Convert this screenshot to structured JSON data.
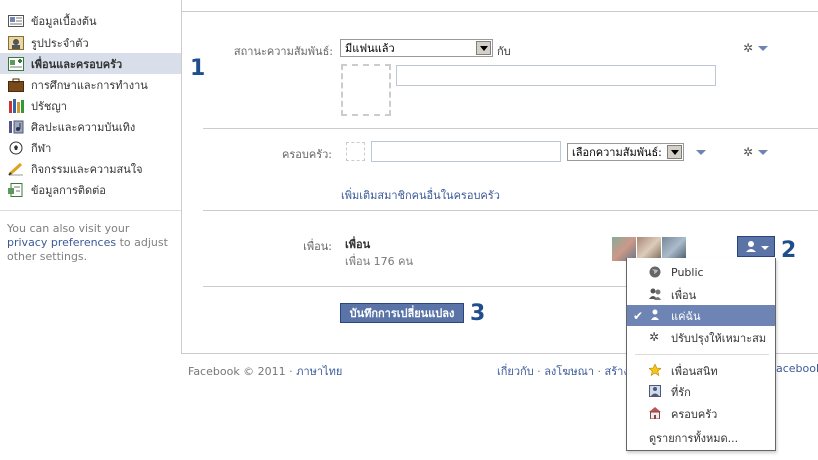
{
  "sidebar": {
    "items": [
      {
        "label": "ข้อมูลเบื้องต้น",
        "icon": "info-card-icon",
        "active": false
      },
      {
        "label": "รูปประจำตัว",
        "icon": "profile-picture-icon",
        "active": false
      },
      {
        "label": "เพื่อนและครอบครัว",
        "icon": "friends-family-icon",
        "active": true
      },
      {
        "label": "การศึกษาและการทำงาน",
        "icon": "briefcase-icon",
        "active": false
      },
      {
        "label": "ปรัชญา",
        "icon": "books-icon",
        "active": false
      },
      {
        "label": "ศิลปะและความบันเทิง",
        "icon": "music-icon",
        "active": false
      },
      {
        "label": "กีฬา",
        "icon": "soccer-ball-icon",
        "active": false
      },
      {
        "label": "กิจกรรมและความสนใจ",
        "icon": "pencil-icon",
        "active": false
      },
      {
        "label": "ข้อมูลการติดต่อ",
        "icon": "contact-icon",
        "active": false
      }
    ],
    "note_prefix": "You can also visit your ",
    "note_link": "privacy preferences",
    "note_suffix": " to adjust other settings."
  },
  "relationship": {
    "label": "สถานะความสัมพันธ์:",
    "select_value": "มีแฟนแล้ว",
    "with_label": "กับ",
    "number_marker": "1"
  },
  "family": {
    "label": "ครอบครัว:",
    "select_value": "เลือกความสัมพันธ์:",
    "add_link": "เพิ่มเติมสมาชิกคนอื่นในครอบครัว"
  },
  "friends": {
    "label": "เพื่อน:",
    "title": "เพื่อน",
    "count_text": "เพื่อน 176 คน",
    "number_marker": "2"
  },
  "save": {
    "label": "บันทึกการเปลี่ยนแปลง",
    "number_marker": "3"
  },
  "privacy_menu": {
    "items": [
      {
        "label": "Public",
        "icon": "globe-icon",
        "selected": false
      },
      {
        "label": "เพื่อน",
        "icon": "friends-icon",
        "selected": false
      },
      {
        "label": "แค่ฉัน",
        "icon": "person-icon",
        "selected": true
      },
      {
        "label": "ปรับปรุงให้เหมาะสม",
        "icon": "gear-icon",
        "selected": false
      },
      {
        "label": "เพื่อนสนิท",
        "icon": "star-icon",
        "selected": false
      },
      {
        "label": "ที่รัก",
        "icon": "partner-icon",
        "selected": false
      },
      {
        "label": "ครอบครัว",
        "icon": "house-icon",
        "selected": false
      }
    ],
    "see_all": "ดูรายการทั้งหมด...",
    "check_mark": "✔"
  },
  "footer": {
    "copyright": "Facebook © 2011",
    "dot": " · ",
    "language": "ภาษาไทย",
    "about": "เกี่ยวกับ",
    "ads": "ลงโฆษณา",
    "create": "สร้างเ",
    "facebook_tail": "acebook"
  },
  "colors": {
    "accent": "#3b5998",
    "button": "#5b74a8",
    "active_bg": "#d8dfea",
    "marker": "#1f4e8c"
  }
}
